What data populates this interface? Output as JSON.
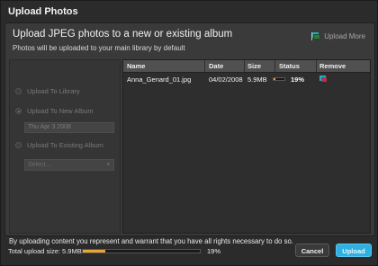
{
  "window": {
    "title": "Upload Photos"
  },
  "panel": {
    "heading": "Upload JPEG photos to a new or existing album",
    "subheading": "Photos will be uploaded to your main library by default",
    "upload_more_label": "Upload More"
  },
  "options": {
    "library_label": "Upload To Library",
    "new_album_label": "Upload To New Album",
    "new_album_value": "Thu Apr 3 2008",
    "existing_album_label": "Upload To Existing Album",
    "existing_album_select": "Select..."
  },
  "table": {
    "columns": [
      "Name",
      "Date",
      "Size",
      "Status",
      "Remove"
    ],
    "rows": [
      {
        "name": "Anna_Genard_01.jpg",
        "date": "04/02/2008",
        "size": "5.9MB",
        "status_pct": "19%",
        "progress": 0.19
      }
    ]
  },
  "notice": "By uploading content you represent and warrant that you have all rights necessary to do so.",
  "footer": {
    "total_label": "Total upload size: 5.9MB",
    "progress_pct": "19%",
    "progress": 0.19,
    "cancel_label": "Cancel",
    "upload_label": "Upload"
  },
  "colors": {
    "accent": "#2fb0e0",
    "progress": "#e9a534"
  }
}
